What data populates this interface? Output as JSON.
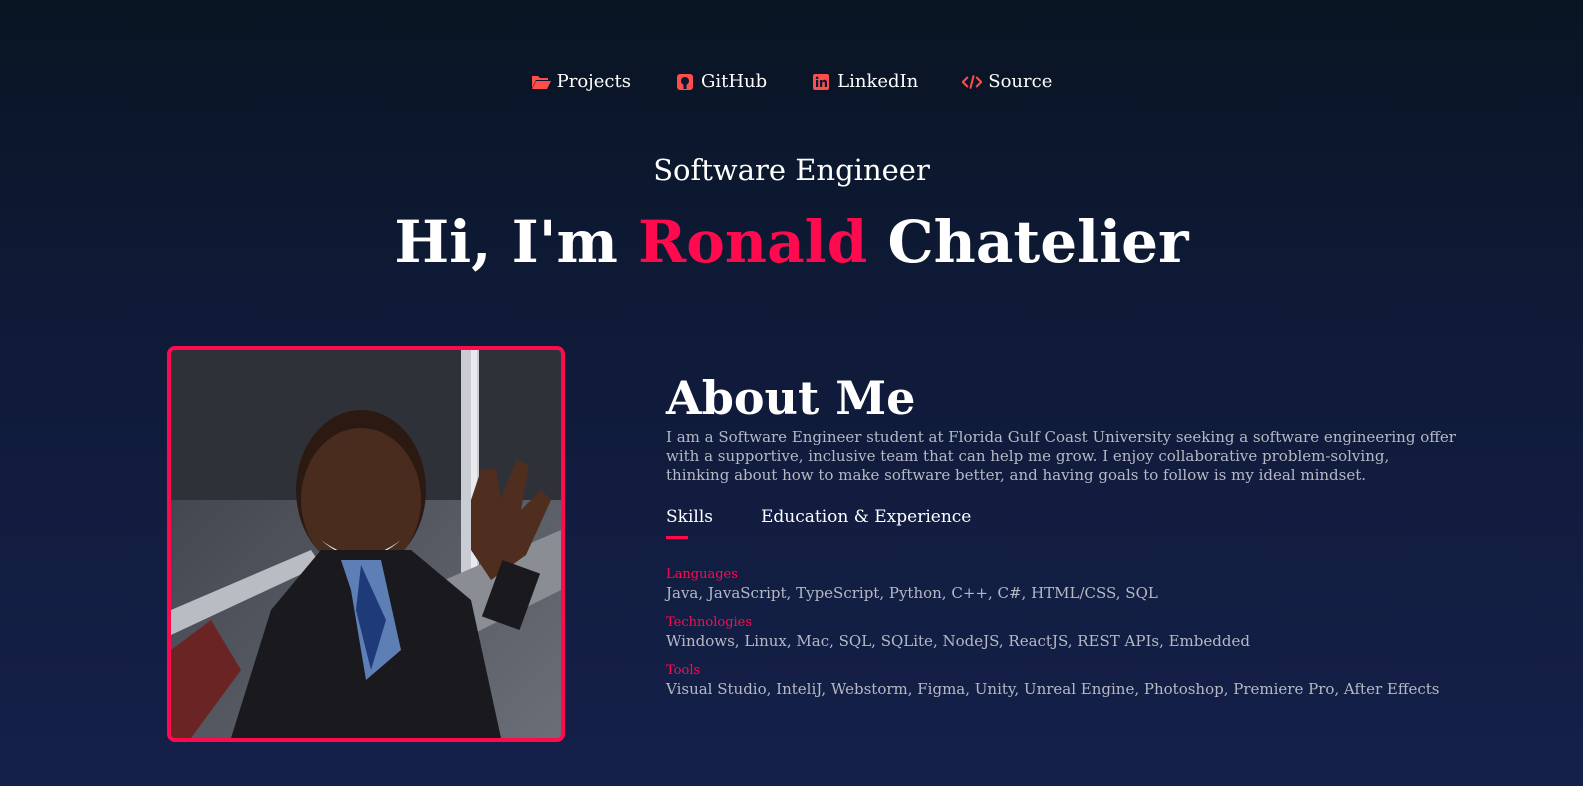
{
  "nav": {
    "items": [
      {
        "label": "Projects",
        "icon": "folder-open-icon"
      },
      {
        "label": "GitHub",
        "icon": "github-icon"
      },
      {
        "label": "LinkedIn",
        "icon": "linkedin-icon"
      },
      {
        "label": "Source",
        "icon": "code-icon"
      }
    ]
  },
  "hero": {
    "subtitle": "Software Engineer",
    "greeting": "Hi, I'm",
    "first_name": "Ronald",
    "last_name": "Chatelier"
  },
  "about": {
    "title": "About Me",
    "bio": "I am a Software Engineer student at Florida Gulf Coast University seeking a software engineering offer with a supportive, inclusive team that can help me grow. I enjoy collaborative problem-solving, thinking about how to make software better, and having goals to follow is my ideal mindset.",
    "tabs": [
      {
        "label": "Skills",
        "active": true
      },
      {
        "label": "Education & Experience",
        "active": false
      }
    ],
    "skills": [
      {
        "title": "Languages",
        "list": "Java, JavaScript, TypeScript, Python, C++, C#, HTML/CSS, SQL"
      },
      {
        "title": "Technologies",
        "list": "Windows, Linux, Mac, SQL, SQLite, NodeJS, ReactJS, REST APIs, Embedded"
      },
      {
        "title": "Tools",
        "list": "Visual Studio, InteliJ, Webstorm, Figma, Unity, Unreal Engine, Photoshop, Premiere Pro, After Effects"
      }
    ]
  },
  "colors": {
    "accent": "#ff0a4e",
    "background_top": "#081522",
    "background_bottom": "#15204a",
    "body_text": "#b6b9c4"
  }
}
